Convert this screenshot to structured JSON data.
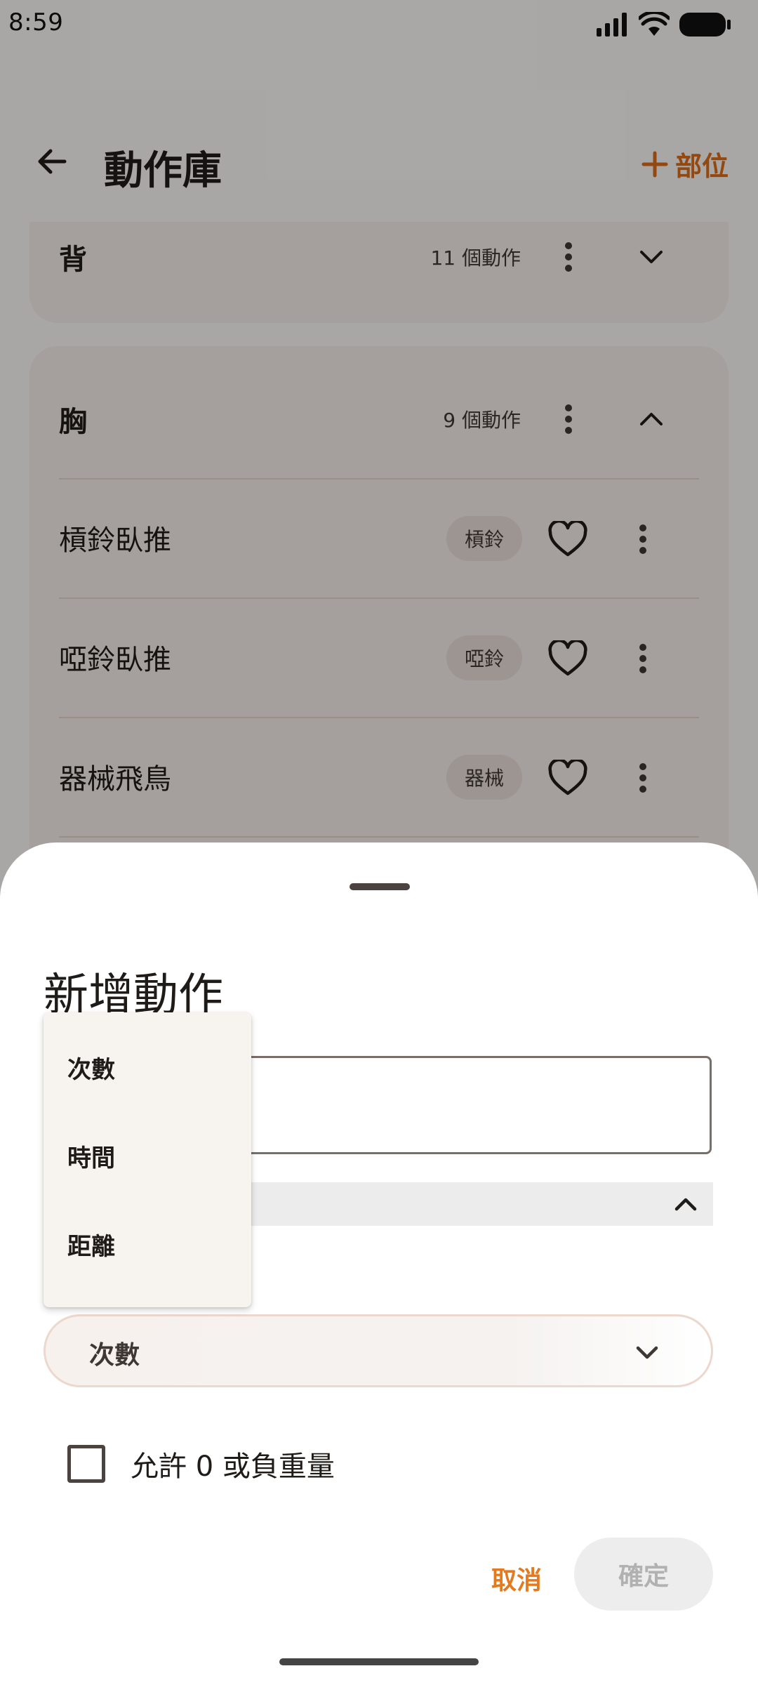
{
  "status_bar": {
    "time": "8:59"
  },
  "app_bar": {
    "title": "動作庫",
    "add_part_label": "部位"
  },
  "groups": [
    {
      "name": "背",
      "count_label": "11 個動作"
    },
    {
      "name": "胸",
      "count_label": "9 個動作",
      "exercises": [
        {
          "name": "槓鈴臥推",
          "equipment": "槓鈴"
        },
        {
          "name": "啞鈴臥推",
          "equipment": "啞鈴"
        },
        {
          "name": "器械飛鳥",
          "equipment": "器械"
        }
      ]
    }
  ],
  "sheet": {
    "title": "新增動作",
    "type_select_value": "次數",
    "checkbox_label": "允許 0 或負重量",
    "cancel_label": "取消",
    "confirm_label": "確定"
  },
  "dropdown": {
    "options": [
      "次數",
      "時間",
      "距離"
    ]
  },
  "colors": {
    "accent": "#d86a16",
    "card": "#f3ece7",
    "scrim": "rgba(0,0,0,0.32)"
  }
}
